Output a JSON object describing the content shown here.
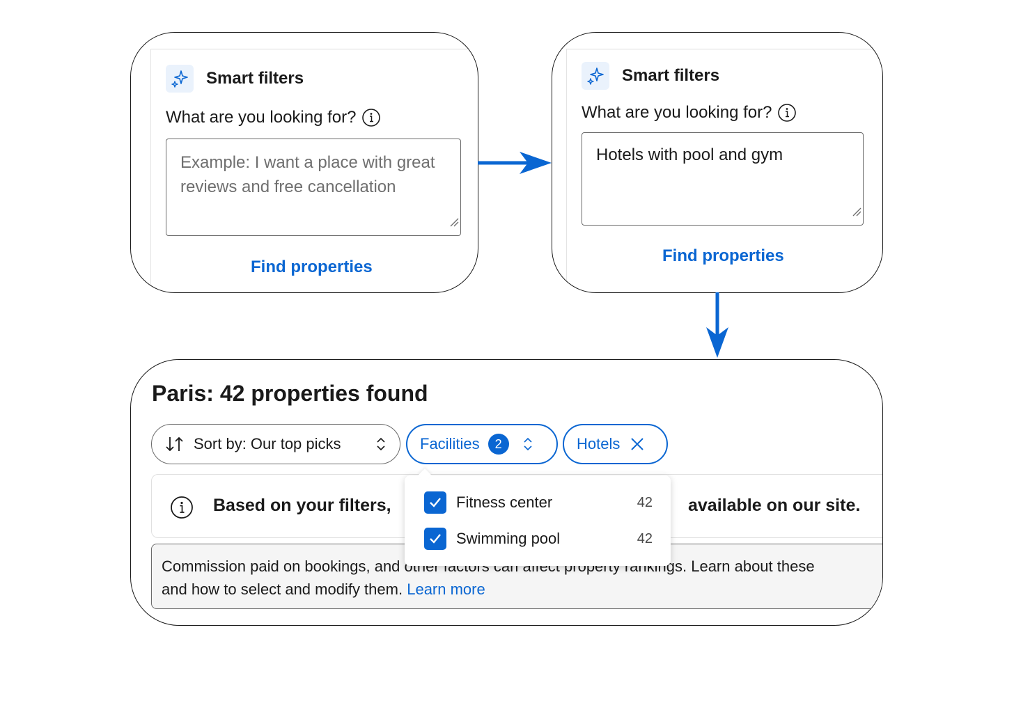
{
  "step1": {
    "title": "Smart filters",
    "question": "What are you looking for?",
    "textarea_placeholder": "Example: I want a place with great reviews and free cancellation",
    "button_label": "Find properties"
  },
  "step2": {
    "title": "Smart filters",
    "question": "What are you looking for?",
    "textarea_value": "Hotels with pool and gym",
    "button_label": "Find properties"
  },
  "results": {
    "title": "Paris: 42 properties found",
    "sort_chip": {
      "icon": "sort-arrows-icon",
      "label": "Sort by: Our top picks"
    },
    "facilities_chip": {
      "label": "Facilities",
      "count": "2"
    },
    "hotels_chip": {
      "label": "Hotels"
    },
    "notice_left": "Based on your filters,",
    "notice_right": "available on our site.",
    "disclaimer_line1": "Commission paid on bookings, and other factors can affect property rankings. Learn about these",
    "disclaimer_line2": "and how to select and modify them.",
    "learn_more": "Learn more",
    "facilities_dropdown": [
      {
        "label": "Fitness center",
        "count": "42",
        "checked": true
      },
      {
        "label": "Swimming pool",
        "count": "42",
        "checked": true
      }
    ]
  },
  "colors": {
    "accent": "#0a66d2",
    "icon_bg": "#eaf2fc",
    "disclaimer_bg": "#f5f5f5"
  },
  "icons": [
    "sparkle-icon",
    "info-icon",
    "resize-handle-icon",
    "sort-arrows-icon",
    "chevron-updown-icon",
    "close-icon",
    "checkmark-icon",
    "arrow-right-icon",
    "arrow-down-icon"
  ]
}
